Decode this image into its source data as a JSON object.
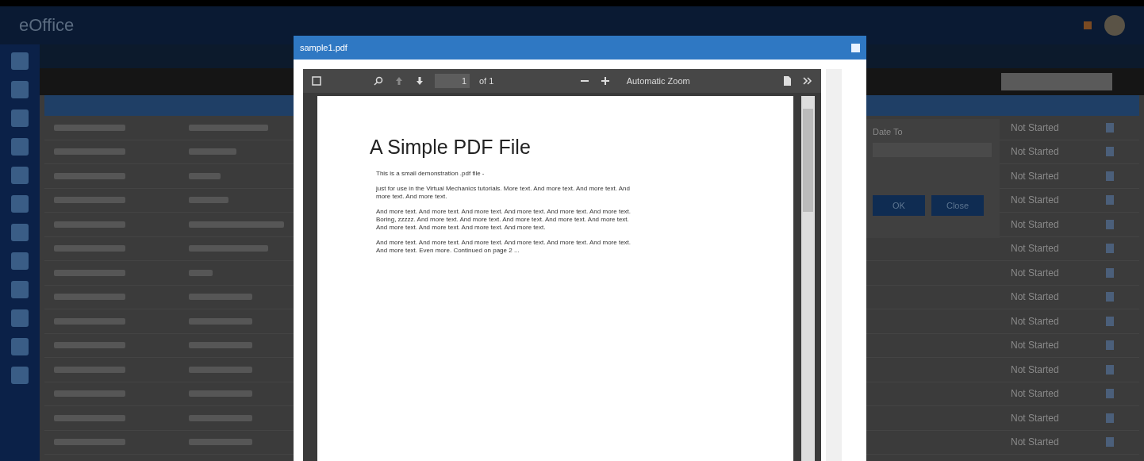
{
  "header": {
    "logo": "eOffice"
  },
  "filter": {
    "label": "Date To",
    "buttons": [
      "OK",
      "Close"
    ]
  },
  "table": {
    "rows": [
      {
        "status": "Not Started"
      },
      {
        "status": "Not Started"
      },
      {
        "status": "Not Started"
      },
      {
        "status": "Not Started"
      },
      {
        "status": "Not Started"
      },
      {
        "status": "Not Started"
      },
      {
        "status": "Not Started"
      },
      {
        "status": "Not Started"
      },
      {
        "status": "Not Started"
      },
      {
        "status": "Not Started"
      },
      {
        "status": "Not Started"
      },
      {
        "status": "Not Started"
      },
      {
        "status": "Not Started"
      },
      {
        "status": "Not Started"
      }
    ]
  },
  "modal": {
    "title": "sample1.pdf",
    "page": "1",
    "page_count": "of 1",
    "zoom": "Automatic Zoom",
    "document": {
      "heading": "A Simple PDF File",
      "paragraphs": [
        "This is a small demonstration .pdf file -",
        "just for use in the Virtual Mechanics tutorials. More text. And more text. And more text. And more text. And more text.",
        "And more text. And more text. And more text. And more text. And more text. And more text. Boring, zzzzz. And more text. And more text. And more text. And more text. And more text. And more text. And more text. And more text. And more text.",
        "And more text. And more text. And more text. And more text. And more text. And more text. And more text. Even more. Continued on page 2 ..."
      ]
    }
  }
}
